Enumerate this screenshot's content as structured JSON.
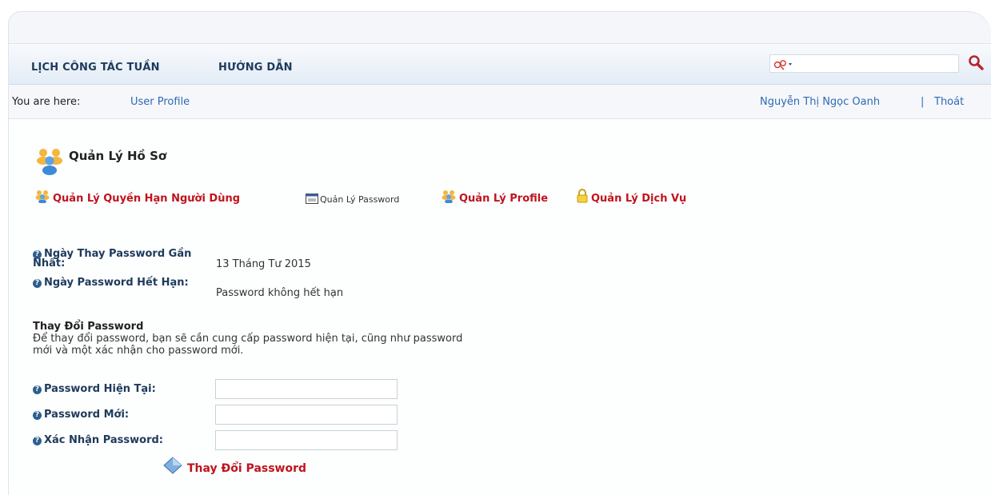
{
  "nav": {
    "items": [
      {
        "label": "LỊCH CÔNG TÁC TUẦN"
      },
      {
        "label": "HƯỚNG DẪN"
      }
    ],
    "search": {
      "value": "",
      "provider_icon": "search-provider-icon"
    }
  },
  "breadcrumb": {
    "label": "You are here:",
    "current": "User Profile"
  },
  "user": {
    "name": "Nguyễn Thị Ngọc Oanh",
    "separator": "|",
    "logout": "Thoát"
  },
  "page": {
    "title": "Quản Lý Hồ Sơ",
    "tabs": [
      {
        "label": "Quản Lý Quyền Hạn Người Dùng",
        "icon": "users-icon"
      },
      {
        "label": "Quản Lý Password",
        "icon": "password-icon"
      },
      {
        "label": "Quản Lý Profile",
        "icon": "users-icon"
      },
      {
        "label": "Quản Lý Dịch Vụ",
        "icon": "lock-icon"
      }
    ],
    "info": [
      {
        "label": "Ngày Thay Password Gần Nhất:",
        "value": "13 Tháng Tư 2015"
      },
      {
        "label": "Ngày Password Hết Hạn:",
        "value": "Password không hết hạn"
      }
    ],
    "change": {
      "title": "Thay Đổi Password",
      "description": "Để thay đổi password, bạn sẽ cần cung cấp password hiện tại, cũng như password mới và một xác nhận cho password mới.",
      "fields": [
        {
          "label": "Password Hiện Tại:",
          "value": ""
        },
        {
          "label": "Password Mới:",
          "value": ""
        },
        {
          "label": "Xác Nhận Password:",
          "value": ""
        }
      ],
      "submit_label": "Thay Đổi Password"
    }
  },
  "colors": {
    "accent_red": "#c0141d",
    "link_blue": "#2f6ab5",
    "nav_text": "#1e3a5c"
  }
}
